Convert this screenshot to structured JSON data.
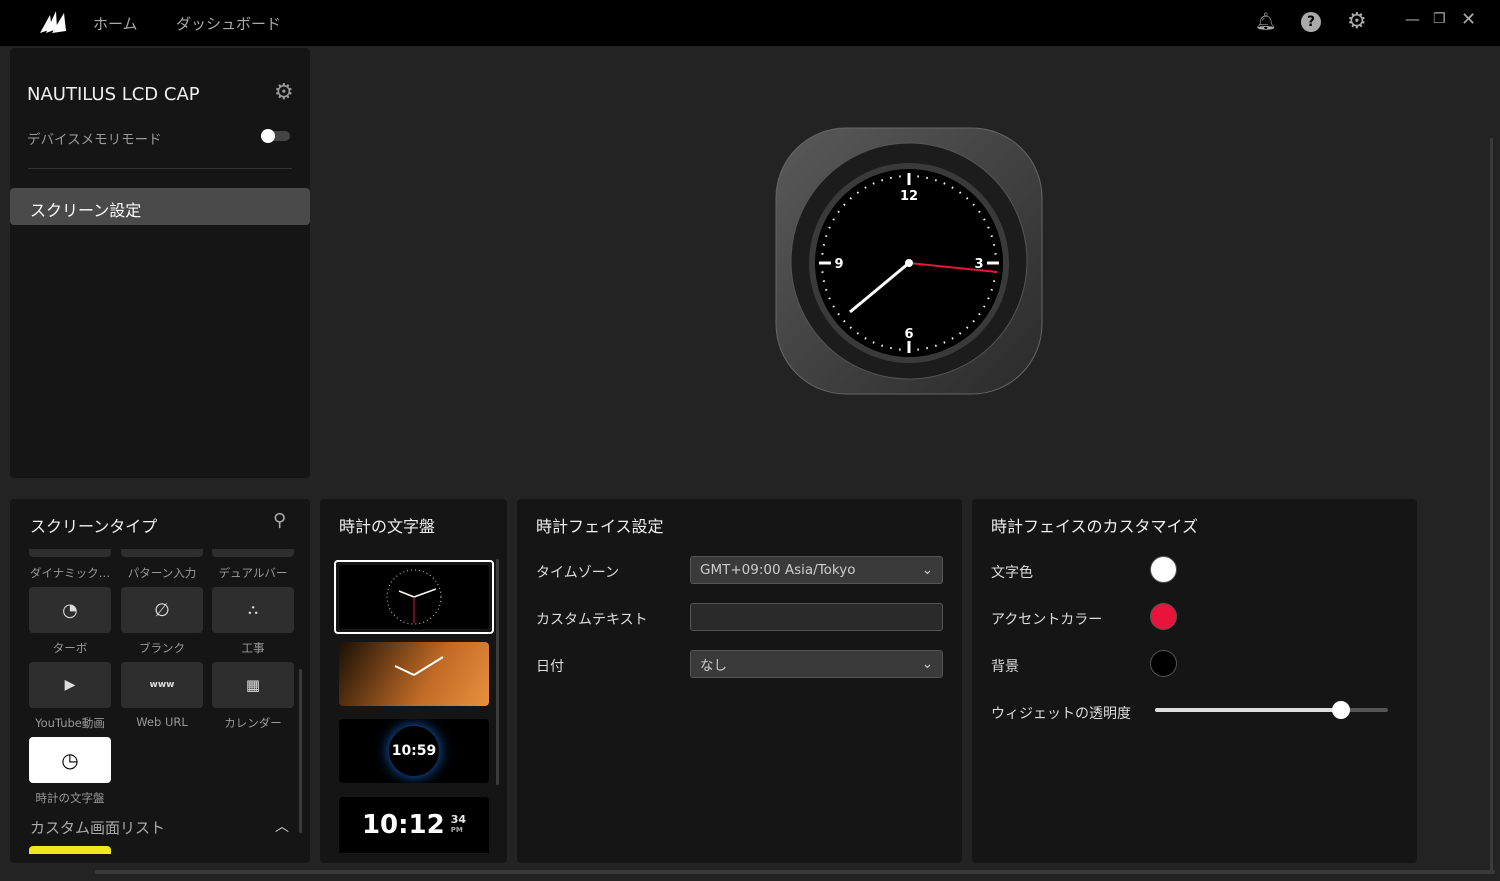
{
  "topbar": {
    "nav": [
      "ホーム",
      "ダッシュボード"
    ],
    "icons": [
      "bell-icon",
      "help-icon",
      "gear-icon",
      "minimize-icon",
      "restore-icon",
      "close-icon"
    ]
  },
  "device": {
    "name": "NAUTILUS LCD CAP",
    "memory_mode_label": "デバイスメモリモード",
    "memory_mode_on": false,
    "menu": [
      "スクリーン設定"
    ]
  },
  "screen_type": {
    "title": "スクリーンタイプ",
    "partial_labels": [
      "ダイナミック…",
      "パターン入力",
      "デュアルバー"
    ],
    "tiles": [
      {
        "label": "ターボ",
        "icon": "turbo-icon"
      },
      {
        "label": "ブランク",
        "icon": "blank-icon"
      },
      {
        "label": "工事",
        "icon": "construction-icon"
      },
      {
        "label": "YouTube動画",
        "icon": "youtube-icon"
      },
      {
        "label": "Web URL",
        "icon": "www-icon"
      },
      {
        "label": "カレンダー",
        "icon": "calendar-icon"
      },
      {
        "label": "時計の文字盤",
        "icon": "clock-icon",
        "selected": true
      }
    ],
    "custom_list": "カスタム画面リスト"
  },
  "faces": {
    "title": "時計の文字盤",
    "digital_a": "10:59",
    "digital_b": "10:12",
    "digital_b_sec": "34",
    "digital_b_ampm": "PM"
  },
  "face_settings": {
    "title": "時計フェイス設定",
    "timezone_label": "タイムゾーン",
    "timezone_value": "GMT+09:00 Asia/Tokyo",
    "custom_text_label": "カスタムテキスト",
    "custom_text_value": "",
    "date_label": "日付",
    "date_value": "なし"
  },
  "customize": {
    "title": "時計フェイスのカスタマイズ",
    "text_color_label": "文字色",
    "text_color": "#ffffff",
    "accent_label": "アクセントカラー",
    "accent_color": "#e8143c",
    "bg_label": "背景",
    "bg_color": "#000000",
    "opacity_label": "ウィジェットの透明度",
    "opacity": 0.8
  },
  "preview": {
    "numerals": [
      "12",
      "3",
      "6",
      "9"
    ]
  }
}
